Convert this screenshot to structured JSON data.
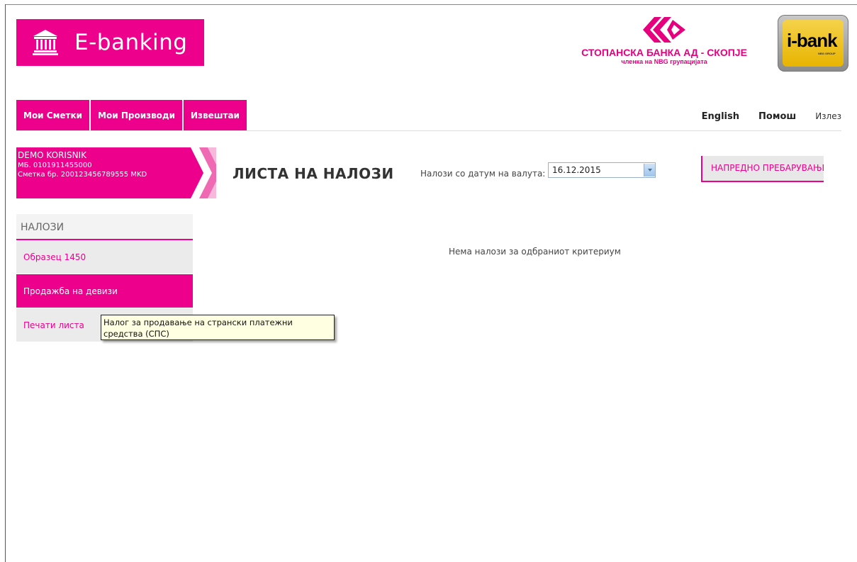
{
  "header": {
    "app_title": "E-banking",
    "bank_name": "СТОПАНСКА БАНКА АД - СКОПЈЕ",
    "bank_subtitle": "членка на NBG групацијата",
    "ibank_label": "i-bank",
    "ibank_sub": "NBG GROUP"
  },
  "nav": {
    "items": [
      {
        "label": "Мои Сметки"
      },
      {
        "label": "Мои Производи"
      },
      {
        "label": "Извештаи"
      }
    ]
  },
  "top_links": {
    "english": "English",
    "help": "Помош",
    "logout": "Излез"
  },
  "user": {
    "name": "DEMO KORISNIK",
    "mb": "МБ. 0101911455000",
    "account": "Сметка бр. 200123456789555 MKD"
  },
  "main": {
    "title": "ЛИСТА НА НАЛОЗИ",
    "date_label": "Налози со датум на валута:",
    "date_value": "16.12.2015",
    "advanced_search": "НАПРЕДНО ПРЕБАРУВАЊЕ",
    "empty_message": "Нема налози за одбраниот критериум"
  },
  "sidebar": {
    "heading": "НАЛОЗИ",
    "items": [
      {
        "label": "Образец 1450"
      },
      {
        "label": "Продажба на девизи"
      },
      {
        "label": "Печати листа"
      }
    ]
  },
  "tooltip": {
    "text": "Налог за продавање на странски платежни средства (СПС)"
  },
  "colors": {
    "brand": "#ec008c",
    "tooltip_bg": "#ffffe1"
  }
}
